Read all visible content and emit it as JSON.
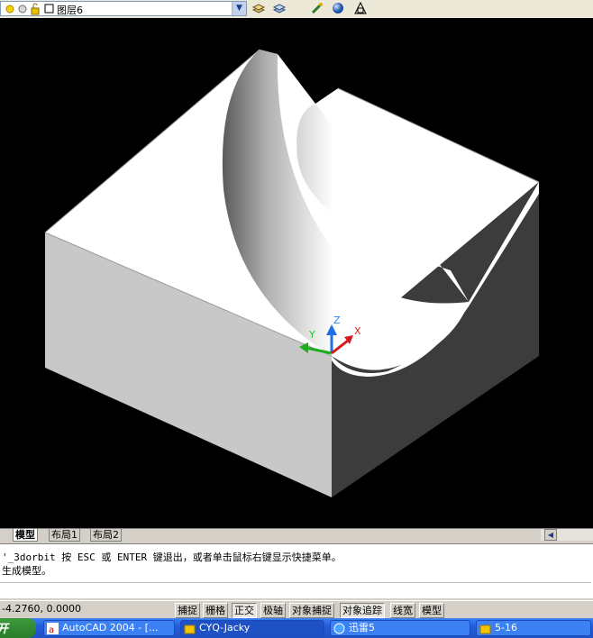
{
  "toolbar": {
    "layer_name": "图层6",
    "icons": [
      "sun-icon",
      "snowflake-icon",
      "lock-icon",
      "color-square-icon",
      "layer-manager-icon",
      "layer-previous-icon",
      "properties-icon",
      "render-sphere-icon",
      "triangle-icon"
    ]
  },
  "viewport": {
    "background": "#000000",
    "ucs": {
      "x_label": "X",
      "y_label": "Y",
      "z_label": "Z"
    }
  },
  "layout_tabs": [
    {
      "label": "模型",
      "active": true
    },
    {
      "label": "布局1",
      "active": false
    },
    {
      "label": "布局2",
      "active": false
    }
  ],
  "command": {
    "line1": "'_3dorbit 按 ESC 或 ENTER 键退出，或者单击鼠标右键显示快捷菜单。",
    "line2": "生成模型。",
    "input": ""
  },
  "status": {
    "coords": "-4.2760, 0.0000",
    "buttons": [
      {
        "label": "捕捉",
        "on": false
      },
      {
        "label": "栅格",
        "on": false
      },
      {
        "label": "正交",
        "on": true
      },
      {
        "label": "极轴",
        "on": false
      },
      {
        "label": "对象捕捉",
        "on": false
      },
      {
        "label": "对象追踪",
        "on": true
      },
      {
        "label": "线宽",
        "on": false
      },
      {
        "label": "模型",
        "on": false
      }
    ]
  },
  "taskbar": {
    "start_label": "开",
    "tasks": [
      {
        "label": "AutoCAD 2004 - [...",
        "active": false
      },
      {
        "label": "CYQ-Jacky",
        "active": true
      },
      {
        "label": "迅雷5",
        "active": false
      },
      {
        "label": "5-16",
        "active": false
      }
    ]
  }
}
